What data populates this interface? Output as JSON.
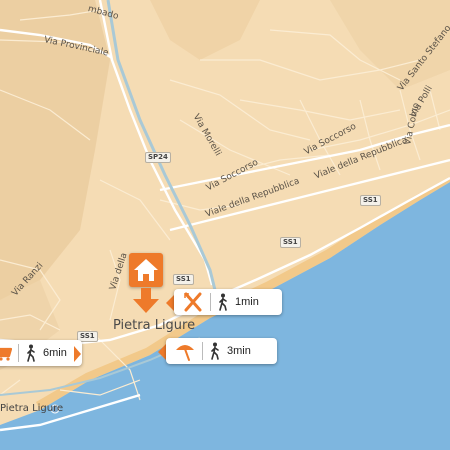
{
  "map": {
    "town_label": "Pietra Ligure",
    "street_labels": {
      "via_provinciale": "Via Provinciale",
      "via_morelli": "Via Morelli",
      "via_soccorso_1": "Via Soccorso",
      "via_soccorso_2": "Via Soccorso",
      "via_repubblica_1": "Viale della Repubblica",
      "via_repubblica_2": "Viale della Repubblica",
      "via_santa_stefano": "Via Santo Stefano",
      "via_polli": "Via Polli",
      "via_como": "Via Como",
      "via_ranzi": "Via Ranzi",
      "via_della": "Via della",
      "top_fragment": "mbado",
      "station": "Pietra Ligure"
    },
    "road_shields": {
      "sp24": "SP24",
      "ss1_a": "SS1",
      "ss1_b": "SS1",
      "ss1_c": "SS1",
      "ss1_d": "SS1"
    },
    "colors": {
      "land": "#f5dcb4",
      "sea": "#7eb6df",
      "accent": "#ee7a2a",
      "rail": "#a9c9d6"
    }
  },
  "pois": {
    "home": {
      "icon": "home-icon"
    },
    "restaurant": {
      "icon": "fork-knife-icon",
      "walk_icon": "walking-person-icon",
      "time": "1min"
    },
    "beach": {
      "icon": "beach-umbrella-icon",
      "walk_icon": "walking-person-icon",
      "time": "3min"
    },
    "shopping": {
      "icon": "shopping-cart-icon",
      "walk_icon": "walking-person-icon",
      "time": "6min"
    }
  }
}
